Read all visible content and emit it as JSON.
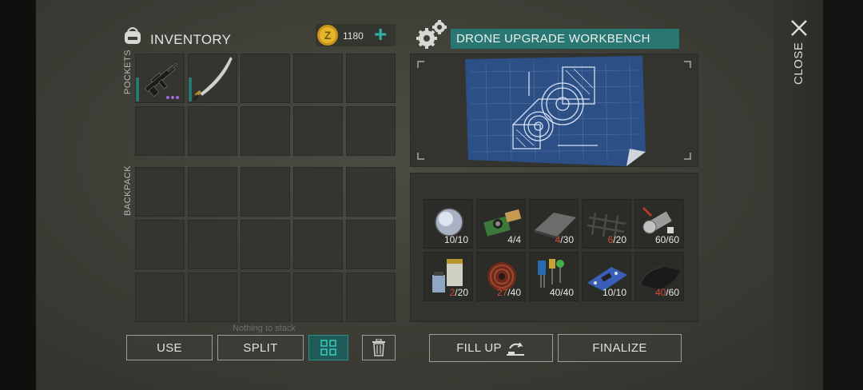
{
  "inventory": {
    "title": "INVENTORY",
    "currency": {
      "amount": "1180",
      "plus": "+"
    },
    "pockets_label": "POCKETS",
    "backpack_label": "BACKPACK",
    "pocket_items": [
      {
        "name": "assault-rifle-icon",
        "durability_dots": 3
      },
      {
        "name": "katana-icon"
      }
    ],
    "stack_hint": "Nothing to stack",
    "buttons": {
      "use": "USE",
      "split": "SPLIT"
    }
  },
  "workbench": {
    "title": "DRONE UPGRADE WORKBENCH",
    "blueprint_icon": "gear-blueprint-icon",
    "materials": [
      {
        "icon": "lens-icon",
        "have": "10",
        "need": "10",
        "low": false
      },
      {
        "icon": "camera-module-icon",
        "have": "4",
        "need": "4",
        "low": false
      },
      {
        "icon": "metal-plate-icon",
        "have": "4",
        "need": "30",
        "low": true
      },
      {
        "icon": "wire-mesh-icon",
        "have": "6",
        "need": "20",
        "low": true
      },
      {
        "icon": "motor-part-icon",
        "have": "60",
        "need": "60",
        "low": false
      },
      {
        "icon": "chemicals-icon",
        "have": "2",
        "need": "20",
        "low": true
      },
      {
        "icon": "copper-coil-icon",
        "have": "27",
        "need": "40",
        "low": true
      },
      {
        "icon": "electronic-components-icon",
        "have": "40",
        "need": "40",
        "low": false
      },
      {
        "icon": "circuit-board-icon",
        "have": "10",
        "need": "10",
        "low": false
      },
      {
        "icon": "rubber-icon",
        "have": "40",
        "need": "60",
        "low": true
      }
    ],
    "buttons": {
      "fill_up": "FILL UP",
      "finalize": "FINALIZE"
    }
  },
  "close_label": "CLOSE",
  "colors": {
    "accent": "#2a7672",
    "low_count": "#d04a3a",
    "coin": "#d9a520",
    "plus": "#2fb3a4"
  }
}
